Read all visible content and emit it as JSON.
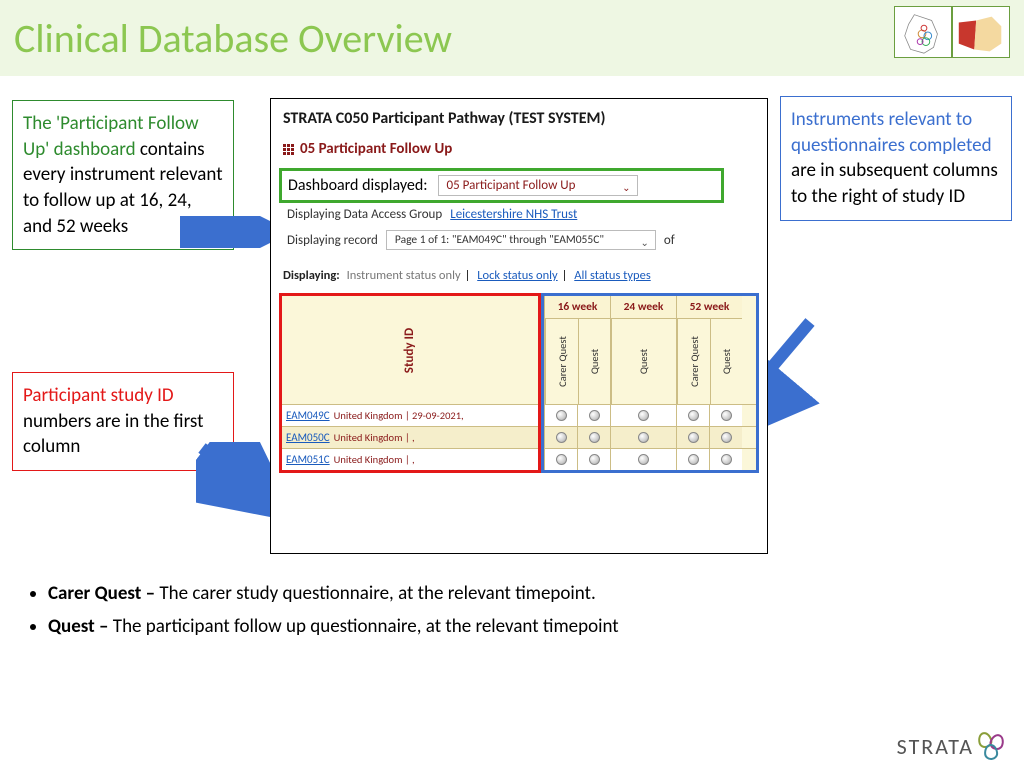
{
  "title": "Clinical Database Overview",
  "annotations": {
    "green_highlight": "The 'Participant Follow Up' dashboard",
    "green_rest": " contains every instrument relevant to follow up at 16, 24, and 52 weeks",
    "red_highlight": "Participant study ID",
    "red_rest": " numbers are in the first column",
    "blue_highlight": "Instruments relevant to questionnaires completed",
    "blue_rest": " are in subsequent columns to the right of study ID"
  },
  "screenshot": {
    "header": "STRATA C050 Participant Pathway (TEST SYSTEM)",
    "subtitle": "05 Participant Follow Up",
    "dashboard_label": "Dashboard displayed:",
    "dashboard_value": "05 Participant Follow Up",
    "dag_label": "Displaying Data Access Group",
    "dag_value": "Leicestershire NHS Trust",
    "record_label": "Displaying record",
    "record_value": "Page 1 of 1: \"EAM049C\" through \"EAM055C\"",
    "record_of": "of",
    "displaying_label": "Displaying:",
    "disp_opt1": "Instrument status only",
    "disp_opt2": "Lock status only",
    "disp_opt3": "All status types",
    "study_id_header": "Study ID",
    "weeks": [
      "16 week",
      "24 week",
      "52 week"
    ],
    "instruments": {
      "w16": [
        "Carer Quest",
        "Quest"
      ],
      "w24": [
        "Quest"
      ],
      "w52": [
        "Carer Quest",
        "Quest"
      ]
    },
    "rows": [
      {
        "id": "EAM049C",
        "sub": "United Kingdom | 29-09-2021,"
      },
      {
        "id": "EAM050C",
        "sub": "United Kingdom | ,"
      },
      {
        "id": "EAM051C",
        "sub": "United Kingdom | ,"
      }
    ]
  },
  "bullets": [
    {
      "term": "Carer Quest –",
      "def": " The carer study questionnaire, at the relevant timepoint."
    },
    {
      "term": "Quest –",
      "def": " The participant follow up questionnaire, at the relevant timepoint"
    }
  ],
  "logo_text": "STRATA"
}
